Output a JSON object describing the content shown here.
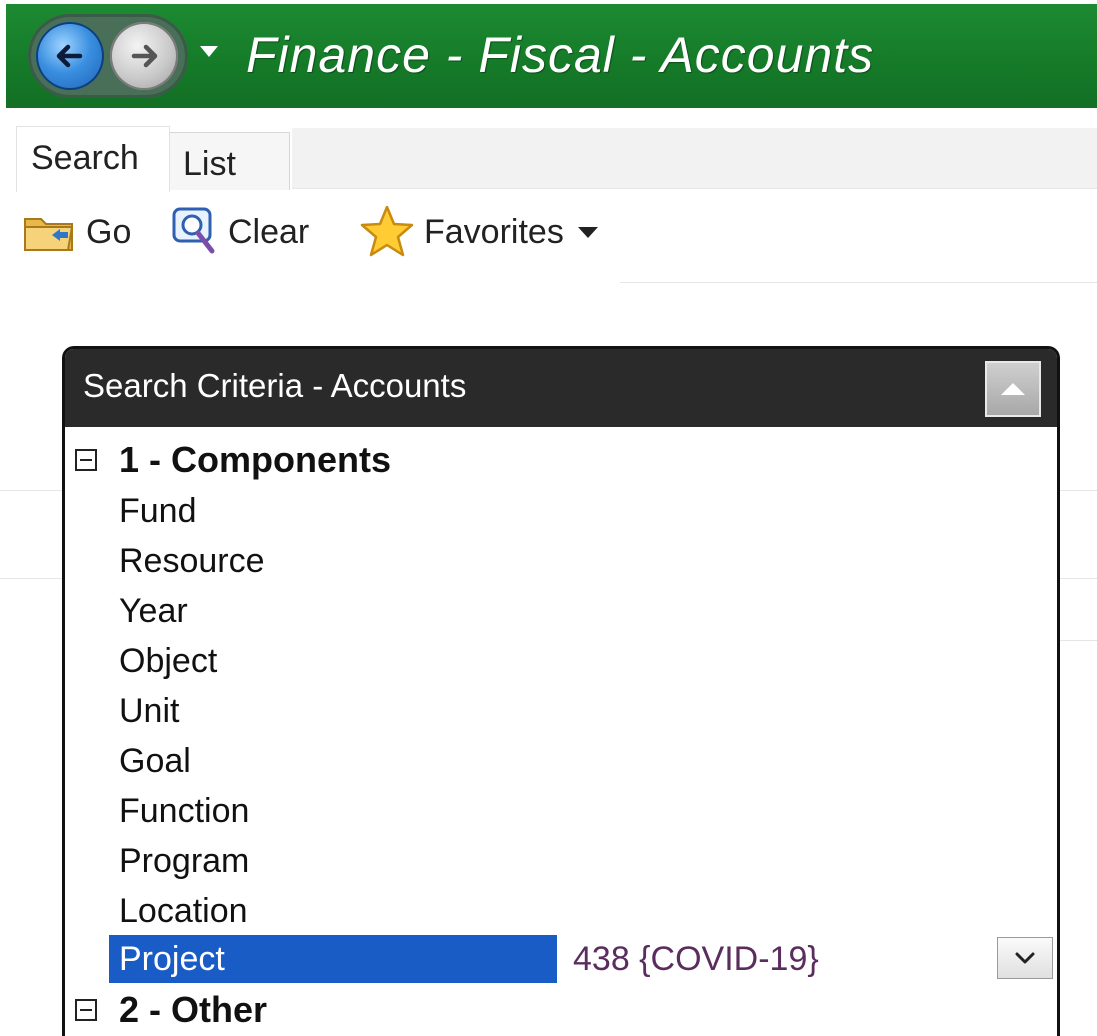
{
  "window": {
    "title": "Finance - Fiscal - Accounts",
    "nav": {
      "back_icon": "arrow-left-icon",
      "forward_icon": "arrow-right-icon",
      "menu_icon": "caret-down-icon"
    },
    "accent": "#157a28"
  },
  "tabs": [
    {
      "label": "Search",
      "active": true
    },
    {
      "label": "List",
      "active": false
    }
  ],
  "toolbar": {
    "go_label": "Go",
    "clear_label": "Clear",
    "favorites_label": "Favorites"
  },
  "panel": {
    "title": "Search Criteria - Accounts",
    "groups": [
      {
        "label": "1 - Components",
        "expanded": true,
        "fields": [
          {
            "label": "Fund"
          },
          {
            "label": "Resource"
          },
          {
            "label": "Year"
          },
          {
            "label": "Object"
          },
          {
            "label": "Unit"
          },
          {
            "label": "Goal"
          },
          {
            "label": "Function"
          },
          {
            "label": "Program"
          },
          {
            "label": "Location"
          },
          {
            "label": "Project",
            "selected": true,
            "value": "438 {COVID-19}"
          }
        ]
      },
      {
        "label": "2 - Other",
        "expanded": true
      }
    ],
    "selection_color": "#1a5cc6"
  }
}
